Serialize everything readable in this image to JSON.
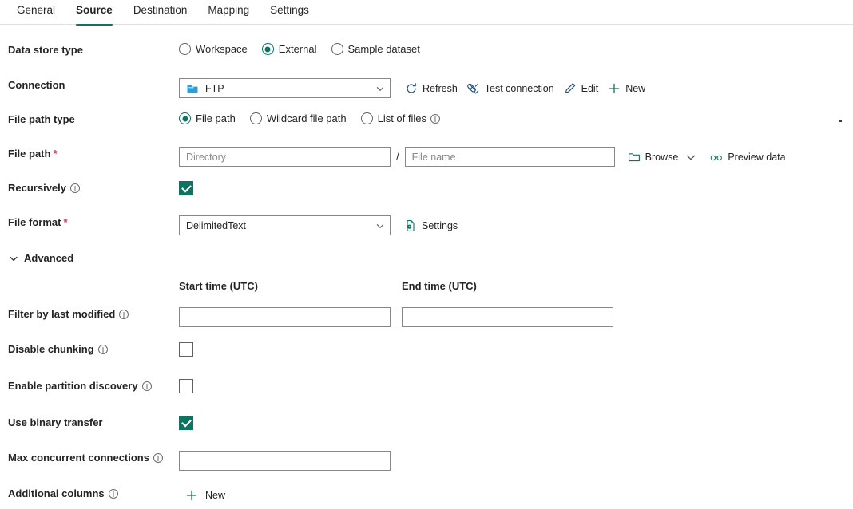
{
  "tabs": [
    {
      "label": "General",
      "active": false
    },
    {
      "label": "Source",
      "active": true
    },
    {
      "label": "Destination",
      "active": false
    },
    {
      "label": "Mapping",
      "active": false
    },
    {
      "label": "Settings",
      "active": false
    }
  ],
  "accent_color": "#0f7362",
  "form": {
    "data_store_type": {
      "label": "Data store type",
      "options": [
        {
          "label": "Workspace",
          "selected": false
        },
        {
          "label": "External",
          "selected": true
        },
        {
          "label": "Sample dataset",
          "selected": false
        }
      ]
    },
    "connection": {
      "label": "Connection",
      "value": "FTP",
      "icon": "folder-icon",
      "commands": [
        {
          "label": "Refresh",
          "icon": "refresh-icon"
        },
        {
          "label": "Test connection",
          "icon": "plug-check-icon"
        },
        {
          "label": "Edit",
          "icon": "pencil-icon"
        },
        {
          "label": "New",
          "icon": "plus-icon"
        }
      ]
    },
    "file_path_type": {
      "label": "File path type",
      "options": [
        {
          "label": "File path",
          "selected": true,
          "info": false
        },
        {
          "label": "Wildcard file path",
          "selected": false,
          "info": false
        },
        {
          "label": "List of files",
          "selected": false,
          "info": true
        }
      ]
    },
    "file_path": {
      "label": "File path",
      "required": "*",
      "directory_placeholder": "Directory",
      "directory_value": "",
      "separator": "/",
      "filename_placeholder": "File name",
      "filename_value": "",
      "browse_label": "Browse",
      "browse_icon": "folder-open-icon",
      "preview_label": "Preview data",
      "preview_icon": "glasses-icon"
    },
    "recursively": {
      "label": "Recursively",
      "checked": true,
      "info": true
    },
    "file_format": {
      "label": "File format",
      "required": "*",
      "value": "DelimitedText",
      "settings_label": "Settings",
      "settings_icon": "file-settings-icon"
    },
    "advanced": {
      "label": "Advanced",
      "expanded": true,
      "icon": "chevron-down-icon"
    },
    "start_time": {
      "header": "Start time (UTC)",
      "value": ""
    },
    "end_time": {
      "header": "End time (UTC)",
      "value": ""
    },
    "filter_by_last_modified": {
      "label": "Filter by last modified",
      "info": true
    },
    "disable_chunking": {
      "label": "Disable chunking",
      "checked": false,
      "info": true
    },
    "enable_partition_discovery": {
      "label": "Enable partition discovery",
      "checked": false,
      "info": true
    },
    "use_binary_transfer": {
      "label": "Use binary transfer",
      "checked": true,
      "info": false
    },
    "max_concurrent_connections": {
      "label": "Max concurrent connections",
      "value": "",
      "info": true
    },
    "additional_columns": {
      "label": "Additional columns",
      "info": true,
      "new_label": "New",
      "new_icon": "plus-icon"
    }
  }
}
